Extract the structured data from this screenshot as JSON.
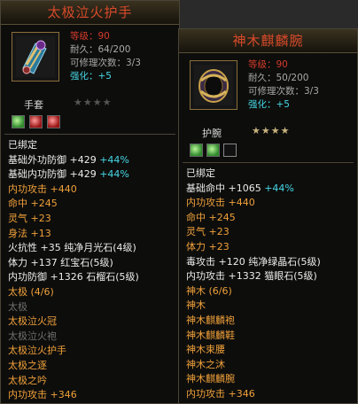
{
  "left": {
    "title": "太极泣火护手",
    "level_label": "等级：",
    "level_value": "90",
    "durability_label": "耐久：",
    "durability_value": "64/200",
    "repair_label": "可修理次数：",
    "repair_value": "3/3",
    "enhance_label": "强化：",
    "enhance_value": "+5",
    "item_type": "手套",
    "stars": "★★★★",
    "gems": [
      "green-gem",
      "red-gem",
      "red-gem"
    ],
    "bound": "已绑定",
    "props": [
      {
        "text": "基础外功防御 +429 ",
        "extra": "+44%",
        "color": "white"
      },
      {
        "text": "基础内功防御 +429 ",
        "extra": "+44%",
        "color": "white"
      },
      {
        "text": "内功攻击 +440",
        "extra": "",
        "color": "orange"
      },
      {
        "text": "命中 +245",
        "extra": "",
        "color": "orange"
      },
      {
        "text": "灵气 +23",
        "extra": "",
        "color": "orange"
      },
      {
        "text": "身法 +13",
        "extra": "",
        "color": "orange"
      },
      {
        "text": "火抗性 +35 纯净月光石(4级)",
        "extra": "",
        "color": "white"
      },
      {
        "text": "体力 +137 红宝石(5级)",
        "extra": "",
        "color": "white"
      },
      {
        "text": "内功防御 +1326 石榴石(5级)",
        "extra": "",
        "color": "white"
      },
      {
        "text": "太极 (4/6)",
        "extra": "",
        "color": "orange"
      },
      {
        "text": "太极",
        "extra": "",
        "color": "gray"
      },
      {
        "text": "太极泣火冠",
        "extra": "",
        "color": "orange"
      },
      {
        "text": "太极泣火袍",
        "extra": "",
        "color": "gray"
      },
      {
        "text": "太极泣火护手",
        "extra": "",
        "color": "orange"
      },
      {
        "text": "太极之逐",
        "extra": "",
        "color": "orange"
      },
      {
        "text": "太极之吟",
        "extra": "",
        "color": "orange"
      },
      {
        "text": "内功攻击 +346",
        "extra": "",
        "color": "orange"
      }
    ]
  },
  "right": {
    "title": "神木麒麟腕",
    "level_label": "等级：",
    "level_value": "90",
    "durability_label": "耐久：",
    "durability_value": "50/200",
    "repair_label": "可修理次数：",
    "repair_value": "3/3",
    "enhance_label": "强化：",
    "enhance_value": "+5",
    "item_type": "护腕",
    "stars": "★★★★",
    "gems": [
      "green-gem",
      "green-gem",
      "empty-slot"
    ],
    "bound": "已绑定",
    "props": [
      {
        "text": "基础命中 +1065 ",
        "extra": "+44%",
        "color": "white"
      },
      {
        "text": "内功攻击 +440",
        "extra": "",
        "color": "orange"
      },
      {
        "text": "命中 +245",
        "extra": "",
        "color": "orange"
      },
      {
        "text": "灵气 +23",
        "extra": "",
        "color": "orange"
      },
      {
        "text": "体力 +23",
        "extra": "",
        "color": "orange"
      },
      {
        "text": "毒攻击 +120 纯净绿晶石(5级)",
        "extra": "",
        "color": "white"
      },
      {
        "text": "内功攻击 +1332 猫眼石(5级)",
        "extra": "",
        "color": "white"
      },
      {
        "text": "神木 (6/6)",
        "extra": "",
        "color": "orange"
      },
      {
        "text": "神木",
        "extra": "",
        "color": "orange"
      },
      {
        "text": "神木麒麟袍",
        "extra": "",
        "color": "orange"
      },
      {
        "text": "神木麒麟鞋",
        "extra": "",
        "color": "orange"
      },
      {
        "text": "神木束腰",
        "extra": "",
        "color": "orange"
      },
      {
        "text": "神木之沐",
        "extra": "",
        "color": "orange"
      },
      {
        "text": "神木麒麟腕",
        "extra": "",
        "color": "orange"
      },
      {
        "text": "内功攻击 +346",
        "extra": "",
        "color": "orange"
      }
    ]
  }
}
